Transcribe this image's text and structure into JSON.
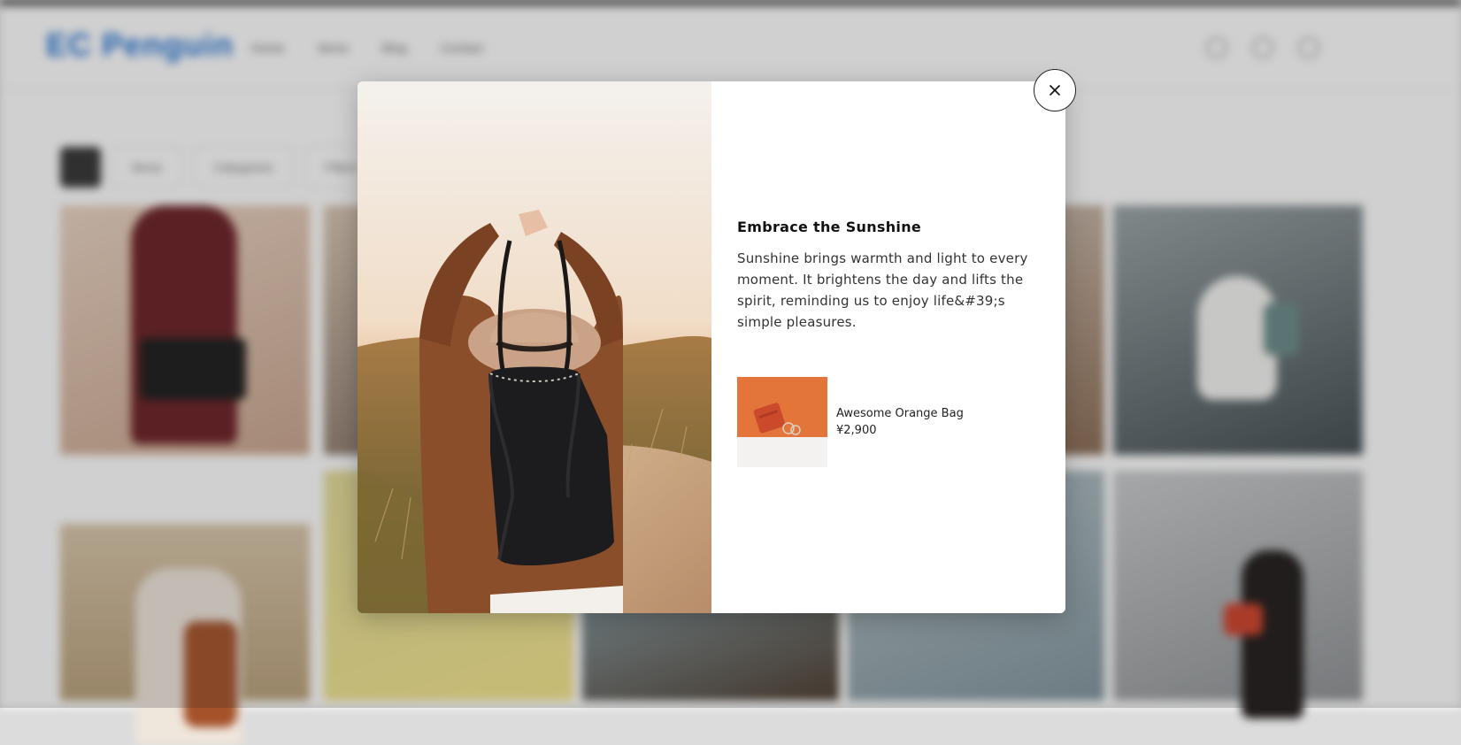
{
  "background": {
    "logo": "EC Penguin",
    "nav": [
      "Home",
      "Items",
      "Blog",
      "Contact"
    ],
    "filters": [
      "Items",
      "Categories",
      "Filters"
    ]
  },
  "modal": {
    "title": "Embrace the Sunshine",
    "body": "Sunshine brings warmth and light to every moment. It brightens the day and lifts the spirit, reminding us to enjoy life&#39;s simple pleasures.",
    "product": {
      "name": "Awesome Orange Bag",
      "price": "¥2,900"
    },
    "close_icon": "close-icon"
  },
  "colors": {
    "brand": "#1f6fd1",
    "overlay": "rgba(40,40,40,0.22)",
    "product_orange": "#e4753a"
  }
}
